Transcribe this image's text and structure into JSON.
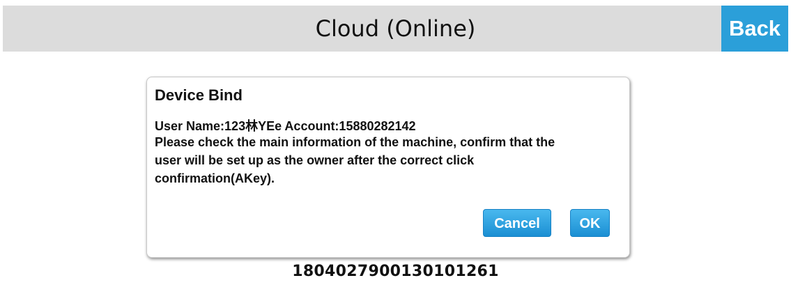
{
  "header": {
    "title": "Cloud (Online)",
    "back_label": "Back"
  },
  "dialog": {
    "title": "Device Bind",
    "user_line": "User Name:123林YEe Account:15880282142",
    "message_lines": [
      "Please check the main information of the machine, confirm that the",
      "user will be set up as the owner after the correct click",
      "confirmation(AKey)."
    ],
    "cancel_label": "Cancel",
    "ok_label": "OK"
  },
  "serial_number": "1804027900130101261",
  "colors": {
    "header_bg": "#dcdcdc",
    "accent": "#2b9fd9",
    "button_blue": "#1b8fd3"
  }
}
